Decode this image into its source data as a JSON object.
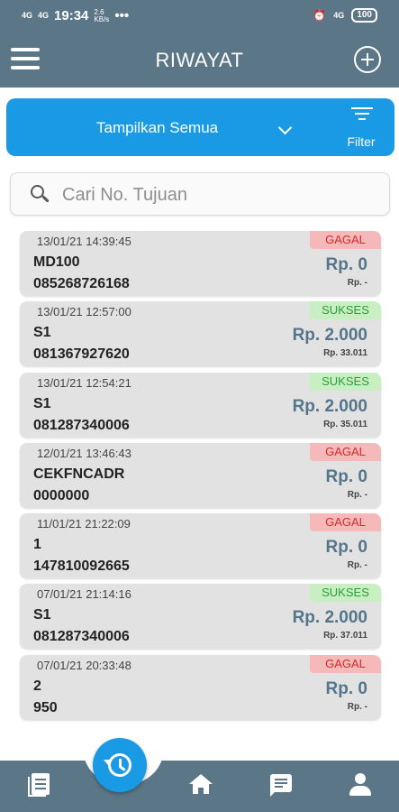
{
  "status_bar": {
    "network_1": "4G",
    "network_2": "4G",
    "time": "19:34",
    "speed_value": "2.6",
    "speed_unit": "KB/s",
    "dots": "•••",
    "lte": "4G",
    "battery": "100"
  },
  "header": {
    "title": "RIWAYAT",
    "menu_icon": "hamburger-menu-icon",
    "add_icon": "plus-circle-icon"
  },
  "filter": {
    "dropdown_label": "Tampilkan Semua",
    "filter_label": "Filter"
  },
  "search": {
    "placeholder": "Cari No. Tujuan"
  },
  "colors": {
    "header": "#5b7787",
    "accent": "#1a9ae4",
    "fail_bg": "#f5b9b9",
    "fail_text": "#d22b2b",
    "ok_bg": "#c7efc2",
    "ok_text": "#2c9c38",
    "price": "#54758a"
  },
  "transactions": [
    {
      "time": "13/01/21 14:39:45",
      "status": "GAGAL",
      "product": "MD100",
      "destination": "085268726168",
      "price": "Rp. 0",
      "balance": "Rp. -"
    },
    {
      "time": "13/01/21 12:57:00",
      "status": "SUKSES",
      "product": "S1",
      "destination": "081367927620",
      "price": "Rp. 2.000",
      "balance": "Rp. 33.011"
    },
    {
      "time": "13/01/21 12:54:21",
      "status": "SUKSES",
      "product": "S1",
      "destination": "081287340006",
      "price": "Rp. 2.000",
      "balance": "Rp. 35.011"
    },
    {
      "time": "12/01/21 13:46:43",
      "status": "GAGAL",
      "product": "CEKFNCADR",
      "destination": "0000000",
      "price": "Rp. 0",
      "balance": "Rp. -"
    },
    {
      "time": "11/01/21 21:22:09",
      "status": "GAGAL",
      "product": "1",
      "destination": "147810092665",
      "price": "Rp. 0",
      "balance": "Rp. -"
    },
    {
      "time": "07/01/21 21:14:16",
      "status": "SUKSES",
      "product": "S1",
      "destination": "081287340006",
      "price": "Rp. 2.000",
      "balance": "Rp. 37.011"
    },
    {
      "time": "07/01/21 20:33:48",
      "status": "GAGAL",
      "product": "2",
      "destination": "950",
      "price": "Rp. 0",
      "balance": "Rp. -"
    }
  ],
  "bottom_nav": {
    "items": [
      "document-list-icon",
      "history-icon",
      "home-icon",
      "chat-icon",
      "user-icon"
    ],
    "active": "history-icon"
  }
}
